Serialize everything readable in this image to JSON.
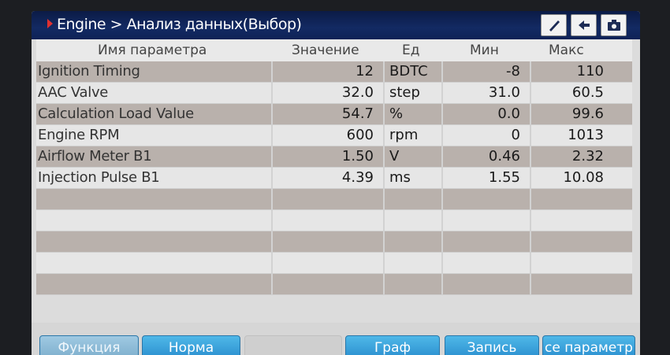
{
  "header": {
    "title": "Engine > Анализ данных(Выбор)",
    "icons": [
      "pen-icon",
      "back-arrow-icon",
      "camera-icon"
    ]
  },
  "columns": {
    "name": "Имя параметра",
    "value": "Значение",
    "unit": "Ед",
    "min": "Мин",
    "max": "Макс"
  },
  "rows": [
    {
      "name": "Ignition Timing",
      "value": "12",
      "unit": "BDTC",
      "min": "-8",
      "max": "110"
    },
    {
      "name": "AAC Valve",
      "value": "32.0",
      "unit": "step",
      "min": "31.0",
      "max": "60.5"
    },
    {
      "name": "Calculation Load Value",
      "value": "54.7",
      "unit": "%",
      "min": "0.0",
      "max": "99.6"
    },
    {
      "name": "Engine RPM",
      "value": "600",
      "unit": "rpm",
      "min": "0",
      "max": "1013"
    },
    {
      "name": "Airflow Meter B1",
      "value": "1.50",
      "unit": "V",
      "min": "0.46",
      "max": "2.32"
    },
    {
      "name": "Injection Pulse B1",
      "value": "4.39",
      "unit": "ms",
      "min": "1.55",
      "max": "10.08"
    }
  ],
  "footer": {
    "function": "Функция",
    "norm": "Норма",
    "graph": "Граф",
    "record": "Запись",
    "all_params": "се параметр"
  }
}
